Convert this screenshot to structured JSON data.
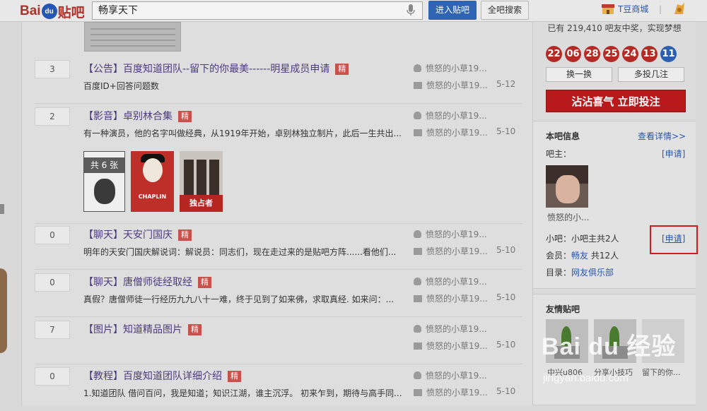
{
  "header": {
    "logo": {
      "bai": "Bai",
      "du": "du",
      "tieba": "贴吧"
    },
    "search_value": "畅享天下",
    "enter_button": "进入贴吧",
    "all_search_button": "全吧搜索",
    "shop_link": "T豆商城",
    "separator": "|"
  },
  "threads": [
    {
      "replies": "3",
      "title": "【公告】百度知道团队--留下的你最美------明星成员申请",
      "badge": "精",
      "excerpt": "百度ID+回答问题数",
      "author": "愤怒的小草19...",
      "last_reply": "愤怒的小草19...",
      "date": "5-12"
    },
    {
      "replies": "2",
      "title": "【影音】卓别林合集",
      "badge": "精",
      "excerpt": "有一种演员，他的名字叫做经典，从1919年开始，卓别林独立制片，此后一生共出...",
      "author": "愤怒的小草19...",
      "last_reply": "愤怒的小草19...",
      "date": "5-10",
      "pics": {
        "count_label": "共 6 张",
        "pic2_text": "CHAPLIN",
        "pic3_text": "独占者"
      }
    },
    {
      "replies": "0",
      "title": "【聊天】天安门国庆",
      "badge": "精",
      "excerpt": "明年的天安门国庆解说词：解说员：同志们，现在走过来的是贴吧方阵......看他们...",
      "author": "愤怒的小草19...",
      "last_reply": "愤怒的小草19...",
      "date": "5-10"
    },
    {
      "replies": "0",
      "title": "【聊天】唐僧师徒经取经",
      "badge": "精",
      "excerpt": "真假？唐僧师徒一行经历九九八十一难，终于见到了如来佛，求取真经. 如来问：...",
      "author": "愤怒的小草19...",
      "last_reply": "愤怒的小草19...",
      "date": "5-10"
    },
    {
      "replies": "7",
      "title": "【图片】知道精品图片",
      "badge": "精",
      "excerpt": "",
      "author": "愤怒的小草19...",
      "last_reply": "愤怒的小草19...",
      "date": "5-10"
    },
    {
      "replies": "0",
      "title": "【教程】百度知道团队详细介绍",
      "badge": "精",
      "excerpt": "1.知道团队 借问百问，我是知道；知识江湖，谁主沉浮。 初来乍到，期待与高手同...",
      "author": "愤怒的小草19...",
      "last_reply": "愤怒的小草19...",
      "date": "5-10"
    }
  ],
  "sidebar": {
    "lottery_text": "已有 219,410 吧友中奖，实现梦想",
    "balls": [
      {
        "num": "22",
        "color": "red"
      },
      {
        "num": "06",
        "color": "red"
      },
      {
        "num": "28",
        "color": "red"
      },
      {
        "num": "25",
        "color": "red"
      },
      {
        "num": "24",
        "color": "red"
      },
      {
        "num": "13",
        "color": "red"
      },
      {
        "num": "11",
        "color": "blue"
      }
    ],
    "change_button": "换一换",
    "multi_button": "多投几注",
    "big_button": "沾沾喜气 立即投注",
    "info": {
      "title": "本吧信息",
      "details_link": "查看详情>>",
      "owner_label": "吧主：",
      "owner_apply": "[申请]",
      "owner_name": "愤怒的小...",
      "small_owner": "小吧：小吧主共2人",
      "small_apply": "[申请]",
      "members_label": "会员：",
      "members_link": "畅友",
      "members_count": "共12人",
      "dir_label": "目录：",
      "dir_link": "网友俱乐部"
    },
    "friends": {
      "title": "友情贴吧",
      "items": [
        "中兴u806",
        "分享小技巧",
        "留下的你..."
      ]
    }
  },
  "watermark": {
    "main": "Bai du 经验",
    "sub": "jingyan.baidu.com"
  },
  "colors": {
    "accent_blue": "#2e64b3",
    "red": "#b8191a",
    "badge": "#c9514c",
    "highlight_box": "#d01c1c"
  }
}
